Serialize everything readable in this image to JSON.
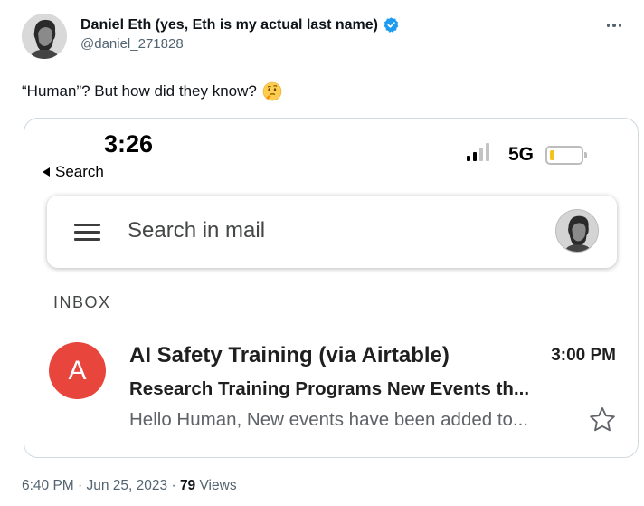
{
  "author": {
    "display_name": "Daniel Eth (yes, Eth is my actual last name)",
    "handle": "@daniel_271828",
    "verified": true
  },
  "tweet": {
    "text": "“Human”? But how did they know?",
    "emoji": "thinking-face"
  },
  "screenshot": {
    "status_bar": {
      "time": "3:26",
      "back_label": "Search",
      "network": "5G",
      "signal_bars": [
        true,
        true,
        false,
        false
      ],
      "battery_level": 0.15
    },
    "search_placeholder": "Search in mail",
    "section_label": "INBOX",
    "email": {
      "avatar_letter": "A",
      "avatar_color": "#e8453c",
      "sender": "AI Safety Training (via Airtable)",
      "time": "3:00 PM",
      "subject": "Research Training Programs New Events th...",
      "snippet": "Hello Human, New events have been added to...",
      "starred": false
    }
  },
  "footer": {
    "timestamp": "6:40 PM · Jun 25, 2023",
    "separator": "·",
    "views_count": "79",
    "views_label": "Views"
  },
  "colors": {
    "verified_blue": "#1d9bf0",
    "text_secondary": "#536471",
    "battery_low": "#f4c21b"
  }
}
